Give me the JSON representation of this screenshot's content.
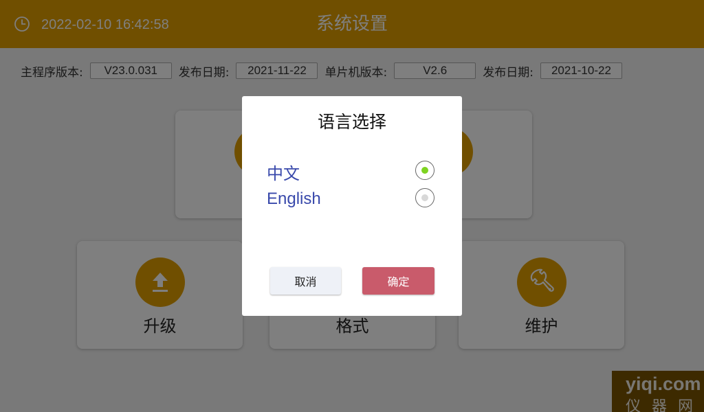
{
  "header": {
    "datetime": "2022-02-10 16:42:58",
    "title": "系统设置",
    "clock_icon": "clock-icon"
  },
  "versions": {
    "main_label": "主程序版本:",
    "main_value": "V23.0.031",
    "main_date_label": "发布日期:",
    "main_date": "2021-11-22",
    "mcu_label": "单片机版本:",
    "mcu_value": "V2.6",
    "mcu_date_label": "发布日期:",
    "mcu_date": "2021-10-22"
  },
  "cards": {
    "upgrade": {
      "label": "升级",
      "icon": "upload-icon"
    },
    "format": {
      "label": "格式"
    },
    "maintain": {
      "label": "维护",
      "icon": "wrench-icon"
    }
  },
  "dialog": {
    "title": "语言选择",
    "options": [
      {
        "label": "中文",
        "selected": true
      },
      {
        "label": "English",
        "selected": false
      }
    ],
    "cancel_label": "取消",
    "ok_label": "确定"
  },
  "watermark": {
    "text": "yiqi.com",
    "sub": "仪器网"
  },
  "colors": {
    "accent": "#e09f00",
    "ok_button": "#c95b6b",
    "option_text": "#3949ab",
    "radio_selected": "#7ed321"
  }
}
